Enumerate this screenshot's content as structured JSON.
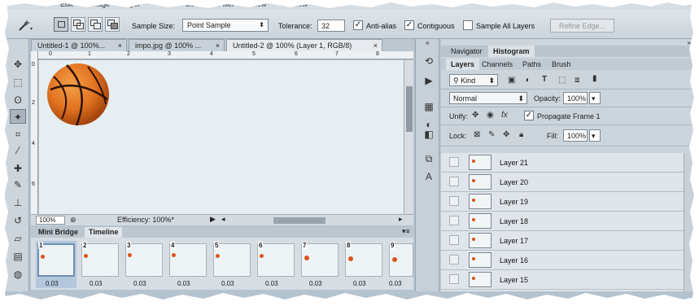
{
  "menubar": [
    "Edit",
    "Image",
    "Layer",
    "Select",
    "Filter",
    "View",
    "Window"
  ],
  "options": {
    "sample_size_label": "Sample Size:",
    "sample_size_value": "Point Sample",
    "tolerance_label": "Tolerance:",
    "tolerance_value": "32",
    "anti_alias_label": "Anti-alias",
    "anti_alias_checked": true,
    "contiguous_label": "Contiguous",
    "contiguous_checked": true,
    "sample_all_layers_label": "Sample All Layers",
    "sample_all_layers_checked": false,
    "refine_edge_label": "Refine Edge..."
  },
  "doc_tabs": [
    {
      "label": "Untitled-1 @ 100%...",
      "close": "×"
    },
    {
      "label": "impo.jpg @ 100% ...",
      "close": "×"
    },
    {
      "label": "Untitled-2 @ 100% (Layer 1, RGB/8)",
      "close": "×"
    }
  ],
  "rulers": {
    "top": [
      "0",
      "1",
      "2",
      "3",
      "4",
      "5",
      "6",
      "7",
      "8"
    ],
    "left": [
      "0",
      "2",
      "4",
      "6"
    ]
  },
  "status": {
    "zoom": "100%",
    "efficiency": "Efficiency: 100%*"
  },
  "timeline_tabs": [
    "Mini Bridge",
    "Timeline"
  ],
  "frames": [
    {
      "num": "1",
      "delay": "0.03"
    },
    {
      "num": "2",
      "delay": "0.03"
    },
    {
      "num": "3",
      "delay": "0.03"
    },
    {
      "num": "4",
      "delay": "0.03"
    },
    {
      "num": "5",
      "delay": "0.03"
    },
    {
      "num": "6",
      "delay": "0.03"
    },
    {
      "num": "7",
      "delay": "0.03"
    },
    {
      "num": "8",
      "delay": "0.03"
    },
    {
      "num": "9",
      "delay": "0.03"
    }
  ],
  "panel": {
    "top_tabs": [
      "Navigator",
      "Histogram"
    ],
    "tabs": [
      "Layers",
      "Channels",
      "Paths",
      "Brush"
    ],
    "filter_kind": "Kind",
    "blend_mode": "Normal",
    "opacity_label": "Opacity:",
    "opacity_value": "100%",
    "unify_label": "Unify:",
    "propagate_label": "Propagate Frame 1",
    "propagate_checked": true,
    "lock_label": "Lock:",
    "fill_label": "Fill:",
    "fill_value": "100%"
  },
  "layers": [
    "Layer 21",
    "Layer 20",
    "Layer 19",
    "Layer 18",
    "Layer 17",
    "Layer 16",
    "Layer 15"
  ],
  "colors": {
    "ball": "#e0711f",
    "ball_dark": "#8a3a0a",
    "accent_selection": "#6d8fb7"
  }
}
